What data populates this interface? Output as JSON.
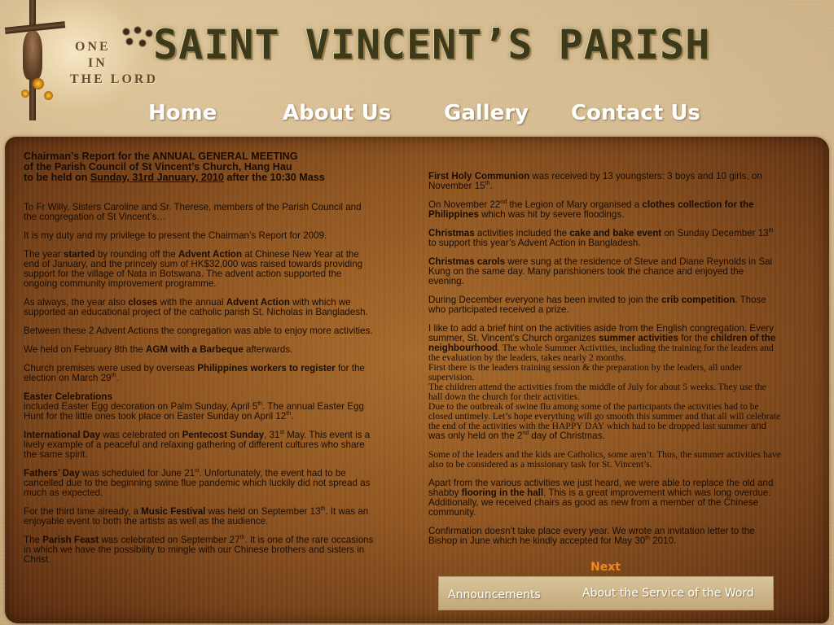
{
  "header": {
    "logo_text": [
      "ONE",
      "IN",
      "THE LORD"
    ],
    "title": "SAINT VINCENT’S PARISH"
  },
  "nav": {
    "home": "Home",
    "about": "About Us",
    "gallery": "Gallery",
    "contact": "Contact Us"
  },
  "report": {
    "heading_line1": "Chairman’s Report for the ANNUAL GENERAL MEETING",
    "heading_line2": "of the Parish Council of St Vincent’s Church, Hang Hau",
    "heading_line3_pre": "to be held on ",
    "heading_line3_date": "Sunday, 31rd January, 2010",
    "heading_line3_post": " after the 10:30 Mass",
    "left": {
      "p1": "To Fr Willy, Sisters Caroline and Sr. Therese, members of the Parish Council and the congregation of St Vincent’s…",
      "p2": "It is my duty and my privilege to present the Chairman’s Report for 2009.",
      "p3_a": "The year ",
      "p3_b": "started",
      "p3_c": " by rounding off the ",
      "p3_d": "Advent Action",
      "p3_e": " at Chinese New Year at the end of January, and the princely sum of HK$32,000 was raised towards providing support for the village of Nata in Botswana. The advent action supported the ongoing community improvement programme.",
      "p4_a": "As always, the year also ",
      "p4_b": "closes",
      "p4_c": " with the annual ",
      "p4_d": "Advent Action",
      "p4_e": " with which we supported an educational project of the catholic parish St. Nicholas in Bangladesh.",
      "p5": "Between these 2 Advent Actions the congregation was able to enjoy more activities.",
      "p6_a": "We held on  February 8th the ",
      "p6_b": "AGM with a Barbeque",
      "p6_c": " afterwards.",
      "p7_a": "Church premises were used by overseas ",
      "p7_b": "Philippines workers to register",
      "p7_c": " for the election on March 29",
      "p7_sup": "th",
      "p7_d": ".",
      "p8_title": "Easter Celebrations",
      "p8_a": "included Easter Egg decoration on Palm Sunday, April 5",
      "p8_sup1": "th",
      "p8_b": ". The annual Easter Egg Hunt  for the little ones took place on Easter Sunday on April 12",
      "p8_sup2": "th",
      "p8_c": ".",
      "p9_a": "International Day",
      "p9_b": " was celebrated on ",
      "p9_c": "Pentecost Sunday",
      "p9_d": ", 31",
      "p9_sup": "st",
      "p9_e": " May. This event is a lively example of a peaceful and relaxing gathering of different cultures who share the same spirit.",
      "p10_a": "Fathers’ Day",
      "p10_b": " was scheduled for June 21",
      "p10_sup": "st",
      "p10_c": ". Unfortunately, the event had to be cancelled due to the beginning swine flue pandemic which luckily did not spread as much as expected.",
      "p11_a": "For the third time already, a ",
      "p11_b": "Music Festival",
      "p11_c": " was held on September 13",
      "p11_sup": "th",
      "p11_d": ". It was an enjoyable event to both the artists as well as the audience.",
      "p12_a": "The ",
      "p12_b": "Parish Feast",
      "p12_c": " was celebrated on September 27",
      "p12_sup": "th",
      "p12_d": ". It is one of the rare occasions in which we have the possibility to mingle with our Chinese brothers and sisters in Christ."
    },
    "right": {
      "p1_a": "First Holy Communion",
      "p1_b": " was received by  13 youngsters: 3 boys and 10 girls, on November 15",
      "p1_sup": "th",
      "p1_c": ".",
      "p2_a": "On November 22",
      "p2_sup": "nd",
      "p2_b": " the Legion of Mary organised a ",
      "p2_c": "clothes collection for the Philippines",
      "p2_d": " which was hit by severe floodings.",
      "p3_a": "Christmas",
      "p3_b": " activities included the ",
      "p3_c": "cake and bake event",
      "p3_d": " on Sunday December 13",
      "p3_sup": "th",
      "p3_e": " to support this year’s Advent Action in Bangladesh.",
      "p4_a": "Christmas carols",
      "p4_b": " were sung at the residence of Steve and Diane Reynolds in Sai Kung on the same day. Many parishioners took the chance and enjoyed the evening.",
      "p5_a": "During December everyone has been invited to join the ",
      "p5_b": "crib competition",
      "p5_c": ". Those who participated received a prize.",
      "p6_a": "I like to add a brief hint on the activities aside from the English congregation. Every summer, St. Vincent’s Church organizes ",
      "p6_b": "summer activities",
      "p6_c": " for the ",
      "p6_d": "children of the neighbourhood",
      "p6_e": ". The whole Summer Activities, including the training for the leaders and the evaluation by the leaders, takes nearly 2 months.",
      "p6_f": "First there is the leaders training session & the preparation by the leaders, all under supervision.",
      "p6_g": "The children attend the activities from the middle of July for about 5 weeks. They use the hall down the church for their activities.",
      "p6_h": "Due to the outbreak of swine flu among some of the participants the activities had to be closed untimely. Let’s hope everything will go smooth this summer and that all will celebrate the end of the activities with the HAPPY DAY which had to be dropped last summer",
      "p6_i": " and was only held on the 2",
      "p6_sup": "nd",
      "p6_j": " day of Christmas.",
      "p7": "Some of the leaders and the kids are Catholics, some aren’t. Thus, the summer activities have also to be considered as a missionary task for St. Vincent’s.",
      "p8_a": "Apart from the various activities we just heard, we were able to replace the old and shabby ",
      "p8_b": "flooring in the hall",
      "p8_c": ". This is a great improvement which was long overdue. Additionally, we received chairs as good as new from a member of the Chinese community.",
      "p9_a": "Confirmation doesn’t take place every year. We wrote an invitation letter to the Bishop in June which he kindly accepted for May 30",
      "p9_sup": "th",
      "p9_b": " 2010."
    }
  },
  "footer": {
    "next": "Next",
    "announcements": "Announcements",
    "service": "About the Service of the Word"
  },
  "colors": {
    "nav_text": "#ffffff",
    "next_link": "#f08a1c",
    "panel": "#8e5522",
    "page_bg": "#c9ab80"
  }
}
